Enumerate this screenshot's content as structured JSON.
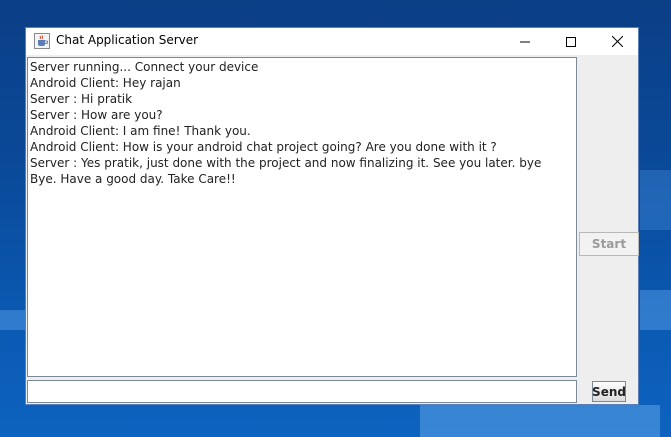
{
  "window": {
    "title": "Chat Application Server",
    "controls": {
      "minimize_glyph": "—",
      "maximize_glyph": "☐",
      "close_glyph": "✕"
    }
  },
  "chat": {
    "lines": [
      "Server running... Connect your device",
      "Android Client: Hey rajan",
      "Server : Hi pratik",
      "Server : How are you?",
      "Android Client: I am fine! Thank you.",
      "Android Client: How is your android chat project going? Are you done with it ?",
      "Server : Yes pratik, just done with the project and now finalizing it. See you later. bye",
      "Bye. Have a good day. Take Care!!"
    ]
  },
  "controls": {
    "start_label": "Start",
    "send_label": "Send",
    "message_input_value": ""
  },
  "icons": {
    "app_icon": "java-cup-icon"
  },
  "colors": {
    "desktop_blue": "#0a4a9a",
    "window_border": "#5a7fb8",
    "panel_gray": "#eeeeee"
  }
}
